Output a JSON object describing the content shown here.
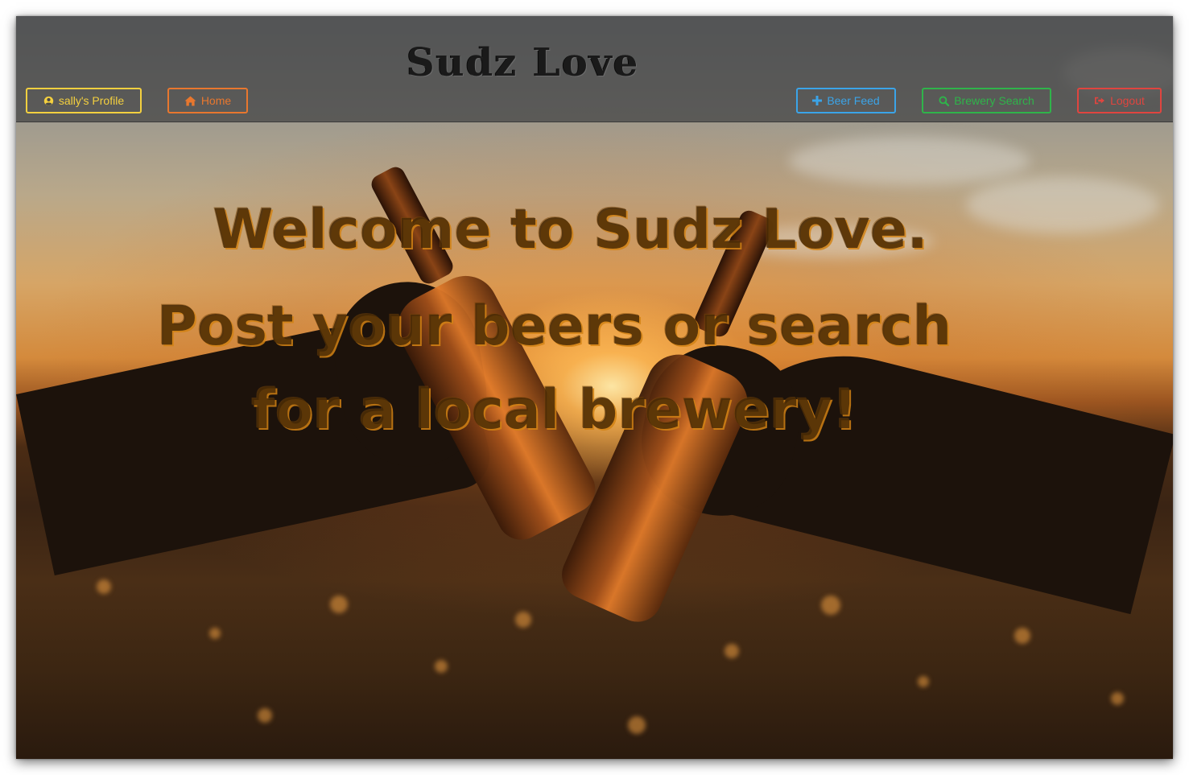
{
  "navbar": {
    "brand": "Sudz Love",
    "profile_label": "sally's Profile",
    "home_label": "Home",
    "beer_feed_label": "Beer Feed",
    "brewery_search_label": "Brewery Search",
    "logout_label": "Logout"
  },
  "hero": {
    "line1": "Welcome to Sudz Love.",
    "line2": "Post your beers or search",
    "line3": "for a local brewery!"
  },
  "icons": {
    "profile": "user-circle-icon",
    "home": "home-icon",
    "beer_feed": "plus-icon",
    "brewery_search": "search-icon",
    "logout": "sign-out-icon"
  },
  "colors": {
    "profile": "#f4d03f",
    "home": "#e8772e",
    "beer_feed": "#3ba4e8",
    "brewery_search": "#2fb44a",
    "logout": "#e0453f"
  }
}
